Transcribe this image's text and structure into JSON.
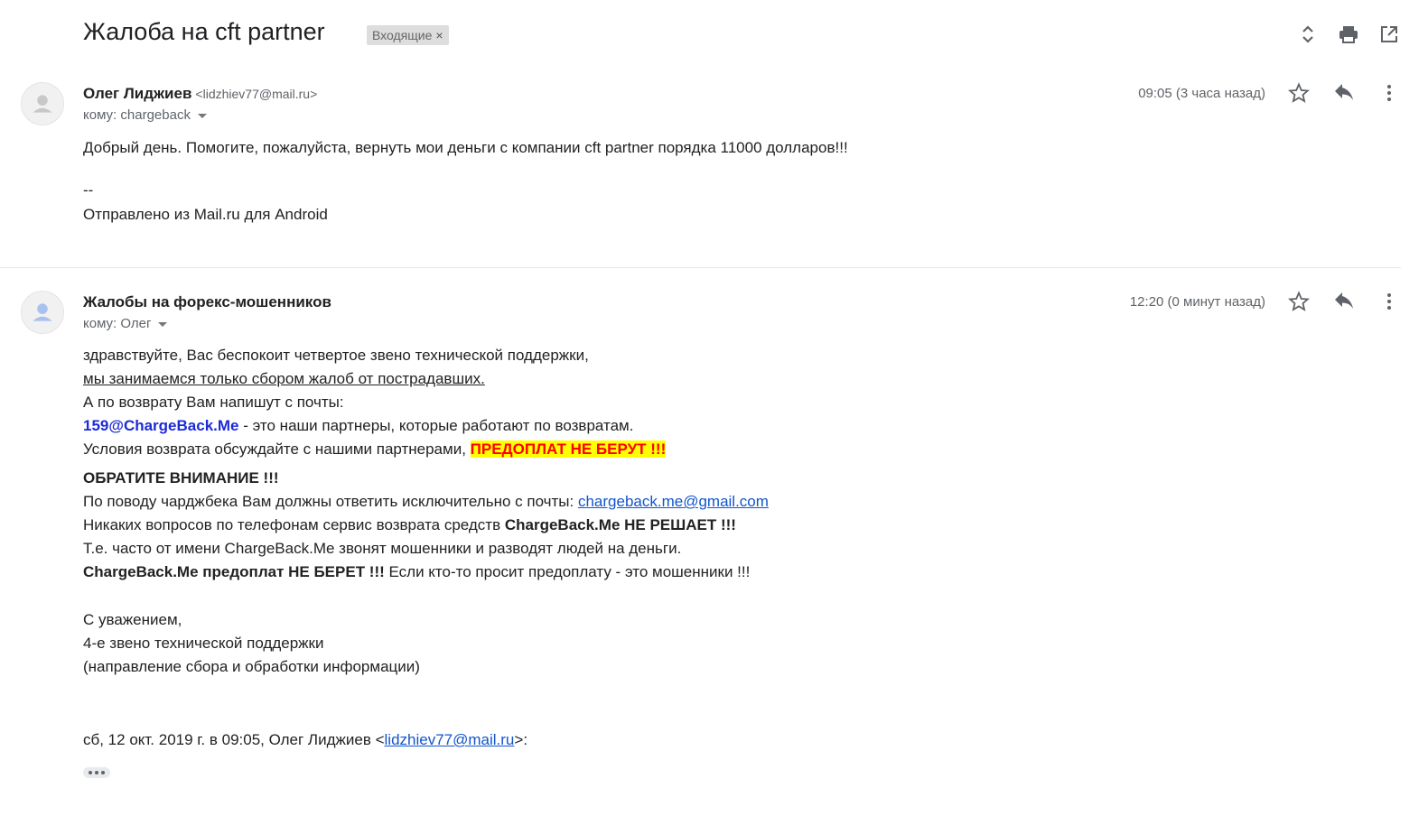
{
  "thread": {
    "subject": "Жалоба на cft partner",
    "label": "Входящие",
    "label_remove": "×",
    "icons": [
      "expand-collapse-icon",
      "print-icon",
      "open-new-window-icon"
    ]
  },
  "message1": {
    "sender_name": "Олег Лиджиев",
    "sender_email": "<lidzhiev77@mail.ru>",
    "to": "кому: chargeback",
    "time": "09:05 (3 часа назад)",
    "body_line1": "Добрый день. Помогите, пожалуйста, вернуть мои деньги с компании cft partner порядка 11000 долларов!!!",
    "sig_sep": "--",
    "sig": "Отправлено из Mail.ru для Android"
  },
  "message2": {
    "sender_name": "Жалобы на форекс-мошенников",
    "to": "кому: Олег",
    "time": "12:20 (0 минут назад)",
    "l1": "здравствуйте, Вас беспокоит четвертое звено технической поддержки,",
    "l2": "мы занимаемся только сбором жалоб от пострадавших.",
    "l3": "А по возврату Вам напишут с почты:",
    "l4_email": "159@ChargeBack.Me",
    "l4_rest": " - это наши партнеры, которые работают по возвратам.",
    "l5_text": "Условия возврата обсуждайте с нашими партнерами, ",
    "l5_hl": "ПРЕДОПЛАТ НЕ БЕРУТ !!!",
    "attention": "ОБРАТИТЕ ВНИМАНИЕ !!!",
    "l7_text": "По поводу чарджбека Вам должны ответить исключительно с почты: ",
    "l7_link": "chargeback.me@gmail.com",
    "l8_text": "Никаких вопросов по телефонам сервис возврата средств ",
    "l8_bold": "ChargeBack.Me НЕ РЕШАЕТ !!!",
    "l9": "Т.е. часто от имени ChargeBack.Me звонят мошенники и разводят людей на деньги.",
    "l10_bold": "ChargeBack.Me предоплат НЕ БЕРЕТ !!!",
    "l10_rest": " Если кто-то просит предоплату - это мошенники !!!",
    "regards": "С уважением,",
    "sig1": "4-е звено технической поддержки",
    "sig2": "(направление сбора и обработки информации)",
    "quote_prefix": "сб, 12 окт. 2019 г. в 09:05, Олег Лиджиев <",
    "quote_link": "lidzhiev77@mail.ru",
    "quote_suffix": ">:"
  }
}
